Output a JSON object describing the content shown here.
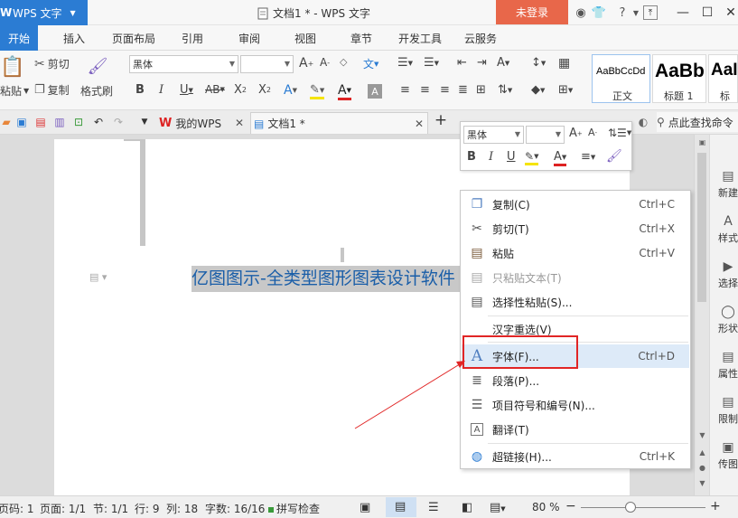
{
  "titlebar": {
    "app_name": "WPS 文字",
    "doc_title": "文档1 * - WPS 文字",
    "login": "未登录"
  },
  "ribbon_tabs": [
    "开始",
    "插入",
    "页面布局",
    "引用",
    "审阅",
    "视图",
    "章节",
    "开发工具",
    "云服务"
  ],
  "ribbon": {
    "paste": "粘贴",
    "cut": "剪切",
    "copy": "复制",
    "format_painter": "格式刷",
    "font_name": "黑体",
    "styles": [
      {
        "preview": "AaBbCcDd",
        "name": "正文"
      },
      {
        "preview": "AaBb",
        "name": "标题 1"
      },
      {
        "preview": "AaI",
        "name": "标题"
      }
    ]
  },
  "tabbar": {
    "tabs": [
      {
        "label": "我的WPS"
      },
      {
        "label": "文档1 *"
      }
    ],
    "search": "点此查找命令"
  },
  "document": {
    "selected_text": "亿图图示-全类型图形图表设计软件"
  },
  "mini_toolbar": {
    "font_name": "黑体"
  },
  "context_menu": {
    "items": [
      {
        "label": "复制(C)",
        "shortcut": "Ctrl+C"
      },
      {
        "label": "剪切(T)",
        "shortcut": "Ctrl+X"
      },
      {
        "label": "粘贴",
        "shortcut": "Ctrl+V"
      },
      {
        "label": "只粘贴文本(T)",
        "shortcut": ""
      },
      {
        "label": "选择性粘贴(S)...",
        "shortcut": ""
      },
      {
        "label": "汉字重选(V)",
        "shortcut": ""
      },
      {
        "label": "字体(F)...",
        "shortcut": "Ctrl+D"
      },
      {
        "label": "段落(P)...",
        "shortcut": ""
      },
      {
        "label": "项目符号和编号(N)...",
        "shortcut": ""
      },
      {
        "label": "翻译(T)",
        "shortcut": ""
      },
      {
        "label": "超链接(H)...",
        "shortcut": "Ctrl+K"
      }
    ]
  },
  "side_panel": [
    "新建",
    "样式",
    "选择",
    "形状",
    "属性",
    "限制",
    "传图"
  ],
  "statusbar": {
    "page_num": "页码: 1",
    "pages": "页面: 1/1",
    "section": "节: 1/1",
    "row": "行: 9",
    "col": "列: 18",
    "words": "字数: 16/16",
    "spell": "拼写检查",
    "zoom": "80 %"
  },
  "colors": {
    "accent": "#2b7cd3",
    "login": "#e8674a",
    "highlight": "#e12525"
  }
}
